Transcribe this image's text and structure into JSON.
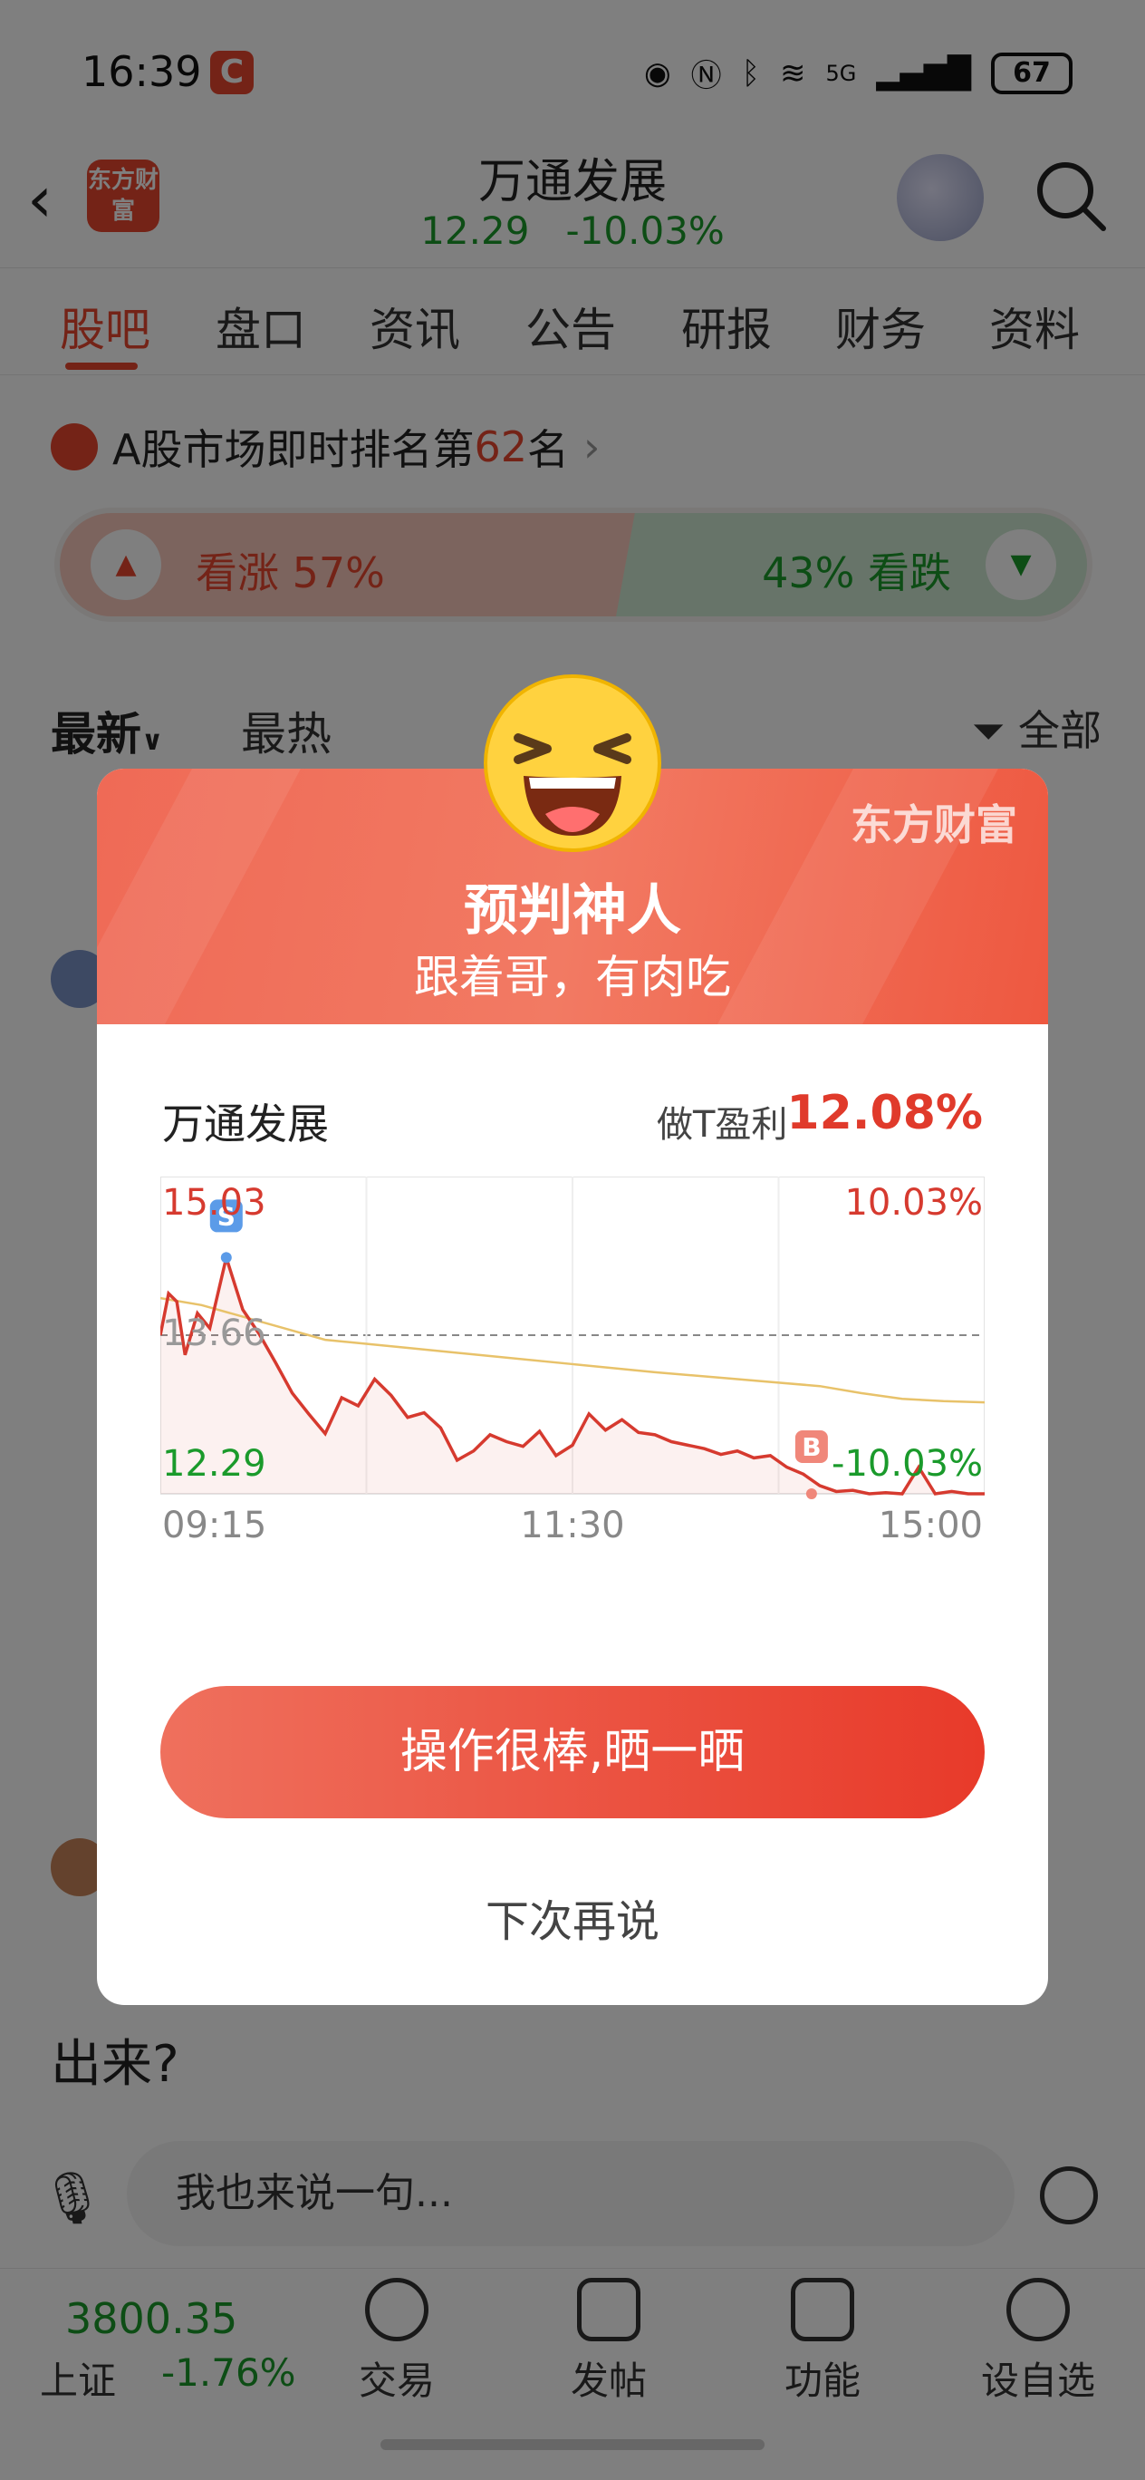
{
  "status_bar": {
    "time": "16:39",
    "app_icon_letter": "C",
    "net": "5G",
    "battery": "67"
  },
  "header": {
    "brand_logo": "东方财富",
    "stock_name": "万通发展",
    "price": "12.29",
    "change": "-10.03%"
  },
  "tabs": [
    "股吧",
    "盘口",
    "资讯",
    "公告",
    "研报",
    "财务",
    "资料"
  ],
  "rank": {
    "prefix": "A股市场即时排名第",
    "number": "62",
    "suffix": "名"
  },
  "vote": {
    "up_label": "看涨 57%",
    "up_percent": 57,
    "down_label": "43% 看跌",
    "down_percent": 43
  },
  "sort": {
    "latest": "最新",
    "hot": "最热",
    "filter": "全部"
  },
  "feed": {
    "post2_text": "出来?"
  },
  "comment_bar": {
    "placeholder": "我也来说一句..."
  },
  "bottom_nav": {
    "index_value": "3800.35",
    "index_name": "上证",
    "index_change": "-1.76%",
    "items": [
      "交易",
      "发帖",
      "功能",
      "设自选"
    ]
  },
  "dialog": {
    "brand": "东方财富",
    "title": "预判神人",
    "subtitle": "跟着哥，有肉吃",
    "stock_name": "万通发展",
    "profit_label": "做T盈利",
    "profit_value": "12.08%",
    "share_button": "操作很棒,晒一晒",
    "later_button": "下次再说"
  },
  "chart_data": {
    "type": "line",
    "y_max_label": "15.03",
    "y_min_label": "12.29",
    "y_mid_label": "13.66",
    "pct_max_label": "10.03%",
    "pct_min_label": "-10.03%",
    "x_labels": [
      "09:15",
      "11:30",
      "15:00"
    ],
    "ylim": [
      12.29,
      15.03
    ],
    "sell_marker": "S",
    "buy_marker": "B",
    "sell_point": {
      "t": 0.08,
      "price": 14.33
    },
    "buy_point": {
      "t": 0.79,
      "price": 12.29
    },
    "colors": {
      "price": "#d63a2f",
      "avg": "#e8c26a",
      "up": "#d63a2f",
      "down": "#1a9a2b"
    },
    "series": [
      {
        "values_t": [
          0.0,
          0.01,
          0.02,
          0.03,
          0.045,
          0.06,
          0.08,
          0.1,
          0.12,
          0.14,
          0.16,
          0.18,
          0.2,
          0.22,
          0.24,
          0.26,
          0.28,
          0.3,
          0.32,
          0.34,
          0.36,
          0.38,
          0.4,
          0.42,
          0.44,
          0.46,
          0.48,
          0.5,
          0.52,
          0.54,
          0.56,
          0.58,
          0.6,
          0.62,
          0.64,
          0.66,
          0.68,
          0.7,
          0.72,
          0.74,
          0.76,
          0.78,
          0.8,
          0.82,
          0.84,
          0.86,
          0.88,
          0.9,
          0.92,
          0.94,
          0.96,
          0.98,
          1.0
        ],
        "values": [
          13.66,
          14.02,
          13.95,
          13.49,
          13.85,
          13.72,
          14.33,
          13.88,
          13.67,
          13.42,
          13.16,
          12.98,
          12.81,
          13.12,
          13.05,
          13.28,
          13.14,
          12.95,
          12.99,
          12.86,
          12.58,
          12.66,
          12.8,
          12.74,
          12.7,
          12.83,
          12.62,
          12.71,
          12.98,
          12.84,
          12.93,
          12.82,
          12.8,
          12.74,
          12.71,
          12.68,
          12.63,
          12.66,
          12.6,
          12.62,
          12.52,
          12.46,
          12.36,
          12.31,
          12.32,
          12.29,
          12.3,
          12.29,
          12.52,
          12.29,
          12.31,
          12.29,
          12.29
        ]
      },
      {
        "values_t": [
          0.0,
          0.05,
          0.1,
          0.15,
          0.2,
          0.3,
          0.4,
          0.5,
          0.6,
          0.7,
          0.8,
          0.85,
          0.9,
          0.95,
          1.0
        ],
        "values": [
          13.98,
          13.92,
          13.82,
          13.72,
          13.62,
          13.55,
          13.48,
          13.41,
          13.34,
          13.28,
          13.22,
          13.16,
          13.11,
          13.09,
          13.08
        ]
      }
    ]
  }
}
